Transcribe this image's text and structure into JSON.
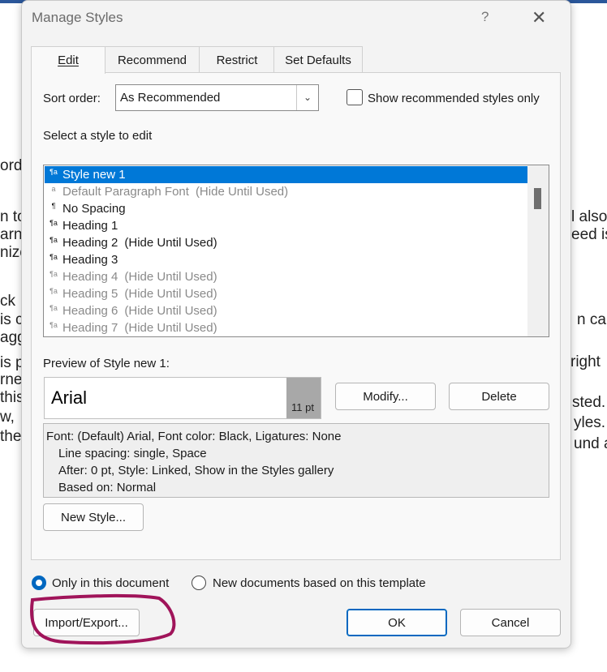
{
  "dialog": {
    "title": "Manage Styles",
    "help": "?",
    "close": "✕"
  },
  "tabs": [
    {
      "label": "Edit",
      "active": true
    },
    {
      "label": "Recommend"
    },
    {
      "label": "Restrict"
    },
    {
      "label": "Set Defaults"
    }
  ],
  "sort": {
    "label": "Sort order:",
    "value": "As Recommended",
    "show_recommended_label": "Show recommended styles only",
    "show_recommended_checked": false
  },
  "style_list": {
    "label": "Select a style to edit",
    "items": [
      {
        "icon": "¶a",
        "name": "Style new 1",
        "note": "",
        "selected": true
      },
      {
        "icon": "a",
        "name": "Default Paragraph Font",
        "note": "(Hide Until Used)",
        "grey": true
      },
      {
        "icon": "¶",
        "name": "No Spacing",
        "note": ""
      },
      {
        "icon": "¶a",
        "name": "Heading 1",
        "note": ""
      },
      {
        "icon": "¶a",
        "name": "Heading 2",
        "note": "(Hide Until Used)"
      },
      {
        "icon": "¶a",
        "name": "Heading 3",
        "note": ""
      },
      {
        "icon": "¶a",
        "name": "Heading 4",
        "note": "(Hide Until Used)",
        "grey": true
      },
      {
        "icon": "¶a",
        "name": "Heading 5",
        "note": "(Hide Until Used)",
        "grey": true
      },
      {
        "icon": "¶a",
        "name": "Heading 6",
        "note": "(Hide Until Used)",
        "grey": true
      },
      {
        "icon": "¶a",
        "name": "Heading 7",
        "note": "(Hide Until Used)",
        "grey": true
      }
    ]
  },
  "preview": {
    "label": "Preview of Style new 1:",
    "font": "Arial",
    "size": "11 pt",
    "modify_label": "Modify...",
    "delete_label": "Delete"
  },
  "description": {
    "lines": [
      "Font: (Default) Arial, Font color: Black, Ligatures: None",
      "Line spacing:  single, Space",
      "After:  0 pt, Style: Linked, Show in the Styles gallery",
      "Based on: Normal"
    ]
  },
  "new_style_label": "New Style...",
  "scope": {
    "option1": "Only in this document",
    "option2": "New documents based on this template",
    "selected": "option1"
  },
  "footer": {
    "import_export_label": "Import/Export...",
    "ok_label": "OK",
    "cancel_label": "Cancel"
  },
  "background_doc": {
    "fragments": [
      "ord",
      "n to",
      "arn",
      "nize",
      "ck",
      "is c",
      "agg",
      "is p",
      "rne",
      "this",
      "w,",
      "the",
      "l also",
      "eed is",
      "n can",
      "right",
      "sted.",
      "yles.",
      "und a"
    ]
  },
  "colors": {
    "accent": "#0078d7",
    "annotation": "#a0145a"
  }
}
